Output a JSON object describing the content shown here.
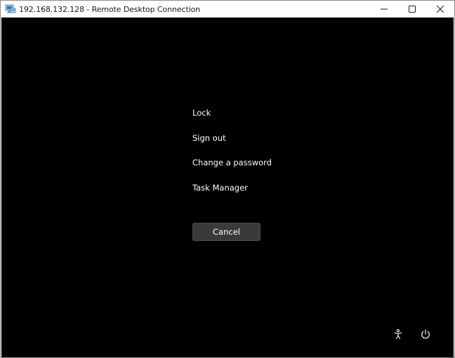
{
  "window": {
    "title": "192.168.132.128 - Remote Desktop Connection",
    "app_icon": "remote-desktop-icon",
    "caption_buttons": [
      "minimize-icon",
      "maximize-icon",
      "close-icon"
    ]
  },
  "security_screen": {
    "options": {
      "lock": "Lock",
      "sign_out": "Sign out",
      "change_password": "Change a password",
      "task_manager": "Task Manager"
    },
    "cancel_label": "Cancel",
    "corner_icons": [
      "accessibility-icon",
      "power-icon"
    ]
  },
  "colors": {
    "background": "#000000",
    "text": "#ffffff",
    "button": "#3a3a3a",
    "titlebar": "#ffffff"
  }
}
